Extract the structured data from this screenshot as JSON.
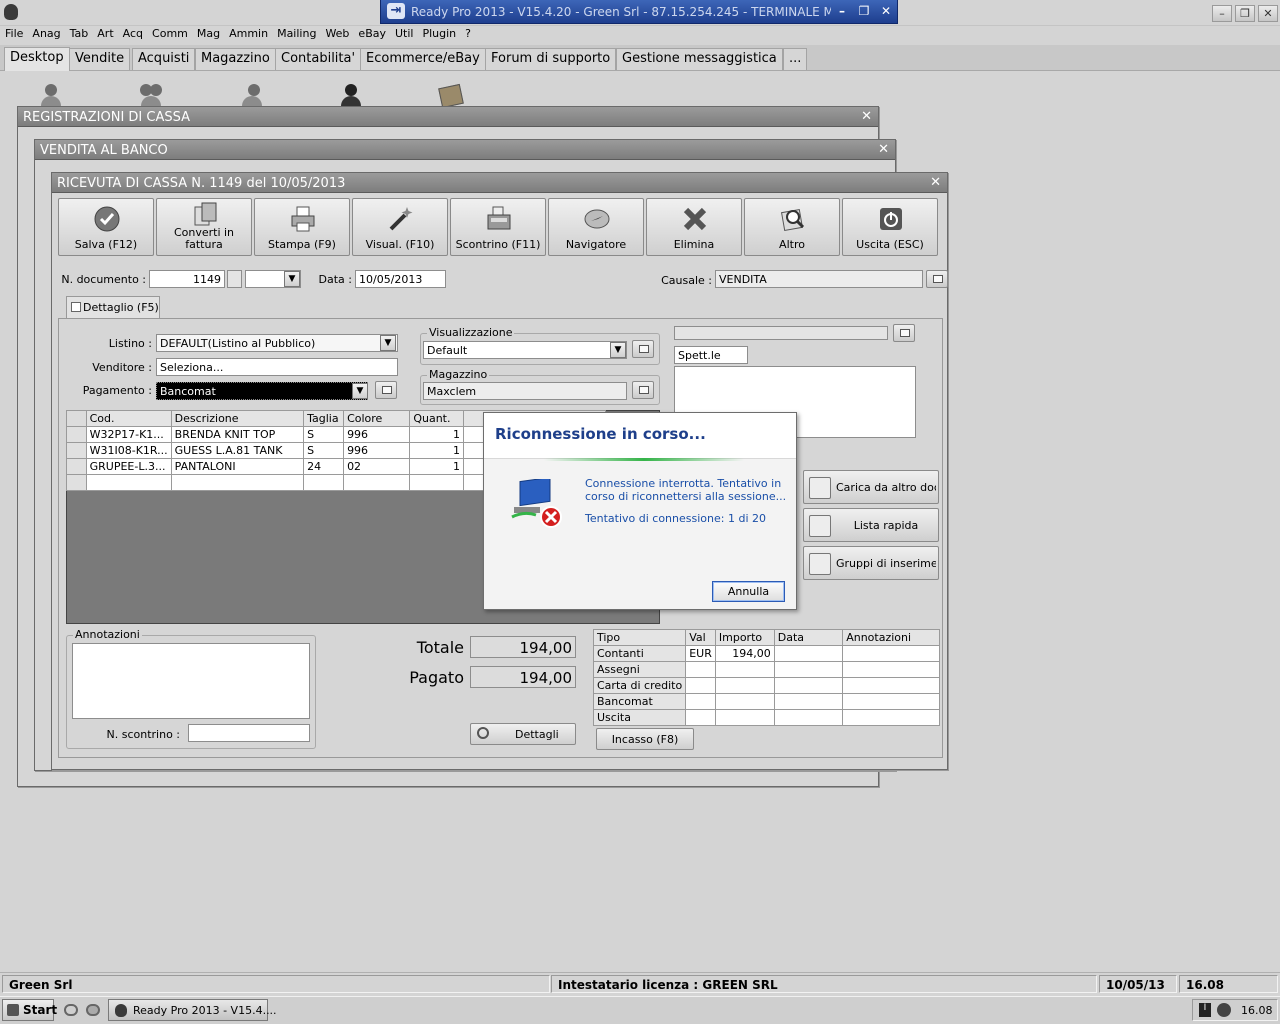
{
  "rdp": {
    "title": "Ready Pro 2013 - V15.4.20 - Green Srl - 87.15.254.245 - TERMINALE MAXCLEM"
  },
  "menu": [
    "File",
    "Anag",
    "Tab",
    "Art",
    "Acq",
    "Comm",
    "Mag",
    "Ammin",
    "Mailing",
    "Web",
    "eBay",
    "Util",
    "Plugin",
    "?"
  ],
  "tabs": [
    "Desktop",
    "Vendite",
    "Acquisti",
    "Magazzino",
    "Contabilita'",
    "Ecommerce/eBay",
    "Forum di supporto",
    "Gestione messaggistica",
    "..."
  ],
  "windows": {
    "reg_cassa": "REGISTRAZIONI DI CASSA",
    "vendita_banco": "VENDITA AL BANCO",
    "ricevuta": "RICEVUTA DI CASSA N. 1149 del 10/05/2013"
  },
  "toolbar": [
    {
      "label": "Salva (F12)",
      "icon": "check-icon"
    },
    {
      "label": "Converti in fattura",
      "icon": "convert-icon"
    },
    {
      "label": "Stampa (F9)",
      "icon": "printer-icon"
    },
    {
      "label": "Visual. (F10)",
      "icon": "magic-wand-icon"
    },
    {
      "label": "Scontrino (F11)",
      "icon": "cash-register-icon"
    },
    {
      "label": "Navigatore",
      "icon": "compass-icon"
    },
    {
      "label": "Elimina",
      "icon": "delete-x-icon"
    },
    {
      "label": "Altro",
      "icon": "magnifier-icon"
    },
    {
      "label": "Uscita (ESC)",
      "icon": "power-icon"
    }
  ],
  "header": {
    "ndoc_label": "N. documento :",
    "ndoc_value": "1149",
    "data_label": "Data :",
    "data_value": "10/05/2013",
    "causale_label": "Causale :",
    "causale_value": "VENDITA"
  },
  "detail_tab": "Dettaglio (F5)",
  "form": {
    "listino_label": "Listino :",
    "listino_value": "DEFAULT(Listino al Pubblico)",
    "venditore_label": "Venditore :",
    "venditore_value": "Seleziona...",
    "pagamento_label": "Pagamento :",
    "pagamento_value": "Bancomat",
    "visual_group": "Visualizzazione",
    "visual_value": "Default",
    "magazzino_group": "Magazzino",
    "magazzino_value": "Maxclem",
    "spett": "Spett.le"
  },
  "items": {
    "columns": [
      "Cod.",
      "Descrizione",
      "Taglia",
      "Colore",
      "Quant."
    ],
    "rows": [
      [
        "W32P17-K1...",
        "BRENDA KNIT TOP",
        "S",
        "996",
        "1"
      ],
      [
        "W31I08-K1R...",
        "GUESS L.A.81 TANK",
        "S",
        "996",
        "1"
      ],
      [
        "GRUPEE-L.3...",
        "PANTALONI",
        "24",
        "02",
        "1"
      ]
    ]
  },
  "side_buttons": [
    {
      "label": "Carica da altro doc.",
      "icon": "checklist-icon"
    },
    {
      "label": "Lista rapida",
      "icon": "list-add-icon"
    },
    {
      "label": "Gruppi di inserimento",
      "icon": "group-insert-icon"
    }
  ],
  "footer": {
    "annotazioni": "Annotazioni",
    "nscontrino_label": "N. scontrino :",
    "totale_label": "Totale",
    "totale_value": "194,00",
    "pagato_label": "Pagato",
    "pagato_value": "194,00",
    "dettagli": "Dettagli",
    "incasso": "Incasso (F8)"
  },
  "payments": {
    "columns": [
      "Tipo",
      "Val",
      "Importo",
      "Data",
      "Annotazioni"
    ],
    "rows": [
      [
        "Contanti",
        "EUR",
        "194,00",
        "",
        ""
      ],
      [
        "Assegni",
        "",
        "",
        "",
        ""
      ],
      [
        "Carta di credito",
        "",
        "",
        "",
        ""
      ],
      [
        "Bancomat",
        "",
        "",
        "",
        ""
      ],
      [
        "Uscita",
        "",
        "",
        "",
        ""
      ]
    ]
  },
  "dialog": {
    "title": "Riconnessione in corso...",
    "message": "Connessione interrotta. Tentativo in corso di riconnettersi alla sessione...",
    "attempt": "Tentativo di connessione: 1 di 20",
    "cancel": "Annulla"
  },
  "status": {
    "company": "Green Srl",
    "license": "Intestatario licenza : GREEN SRL",
    "date": "10/05/13",
    "time": "16.08"
  },
  "taskbar": {
    "start": "Start",
    "task": "Ready Pro 2013 - V15.4....",
    "clock": "16.08"
  }
}
